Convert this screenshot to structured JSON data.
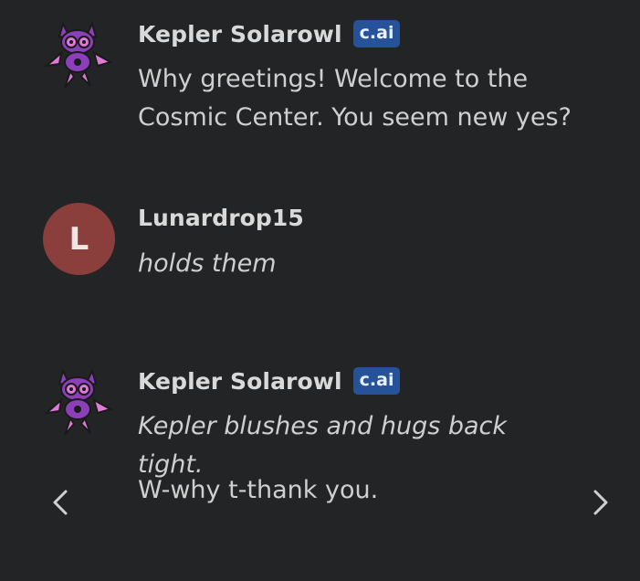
{
  "messages": [
    {
      "author": "Kepler Solarowl",
      "badge": "c.ai",
      "text": "Why greetings! Welcome to the Cosmic Center. You seem new yes?"
    },
    {
      "author": "Lunardrop15",
      "avatar_letter": "L",
      "text": "holds them"
    },
    {
      "author": "Kepler Solarowl",
      "badge": "c.ai",
      "text_action": "Kepler blushes and hugs back tight.",
      "text_reply": "W-why t-thank you."
    }
  ],
  "icons": {
    "prev": "chevron-left-icon",
    "next": "chevron-right-icon"
  },
  "colors": {
    "background": "#232425",
    "badge": "#26529a",
    "user_avatar": "#8a3f3d",
    "bot_avatar_purple": "#8b3fb8",
    "bot_avatar_pink": "#e07ad8"
  }
}
